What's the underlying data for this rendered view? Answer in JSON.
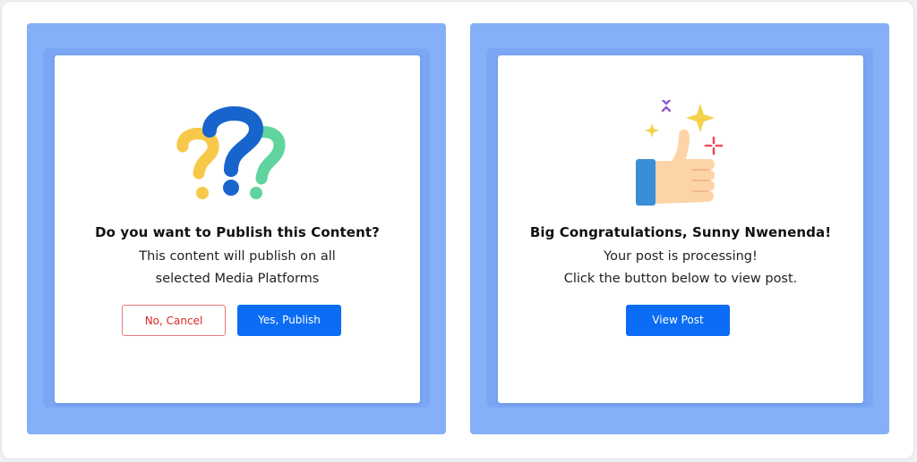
{
  "publish_dialog": {
    "title": "Do you want to Publish this Content?",
    "message_line1": "This content will publish on all",
    "message_line2": "selected Media Platforms",
    "cancel_label": "No, Cancel",
    "confirm_label": "Yes, Publish",
    "icon": "question-marks-icon"
  },
  "success_dialog": {
    "title": "Big Congratulations, Sunny Nwenenda!",
    "message_line1": "Your post is processing!",
    "message_line2": "Click the button below to view post.",
    "view_label": "View Post",
    "icon": "thumbs-up-icon"
  },
  "colors": {
    "backdrop": "#85aff7",
    "primary": "#0b6cf5",
    "danger": "#e02424",
    "danger_border": "#e27b7b"
  }
}
